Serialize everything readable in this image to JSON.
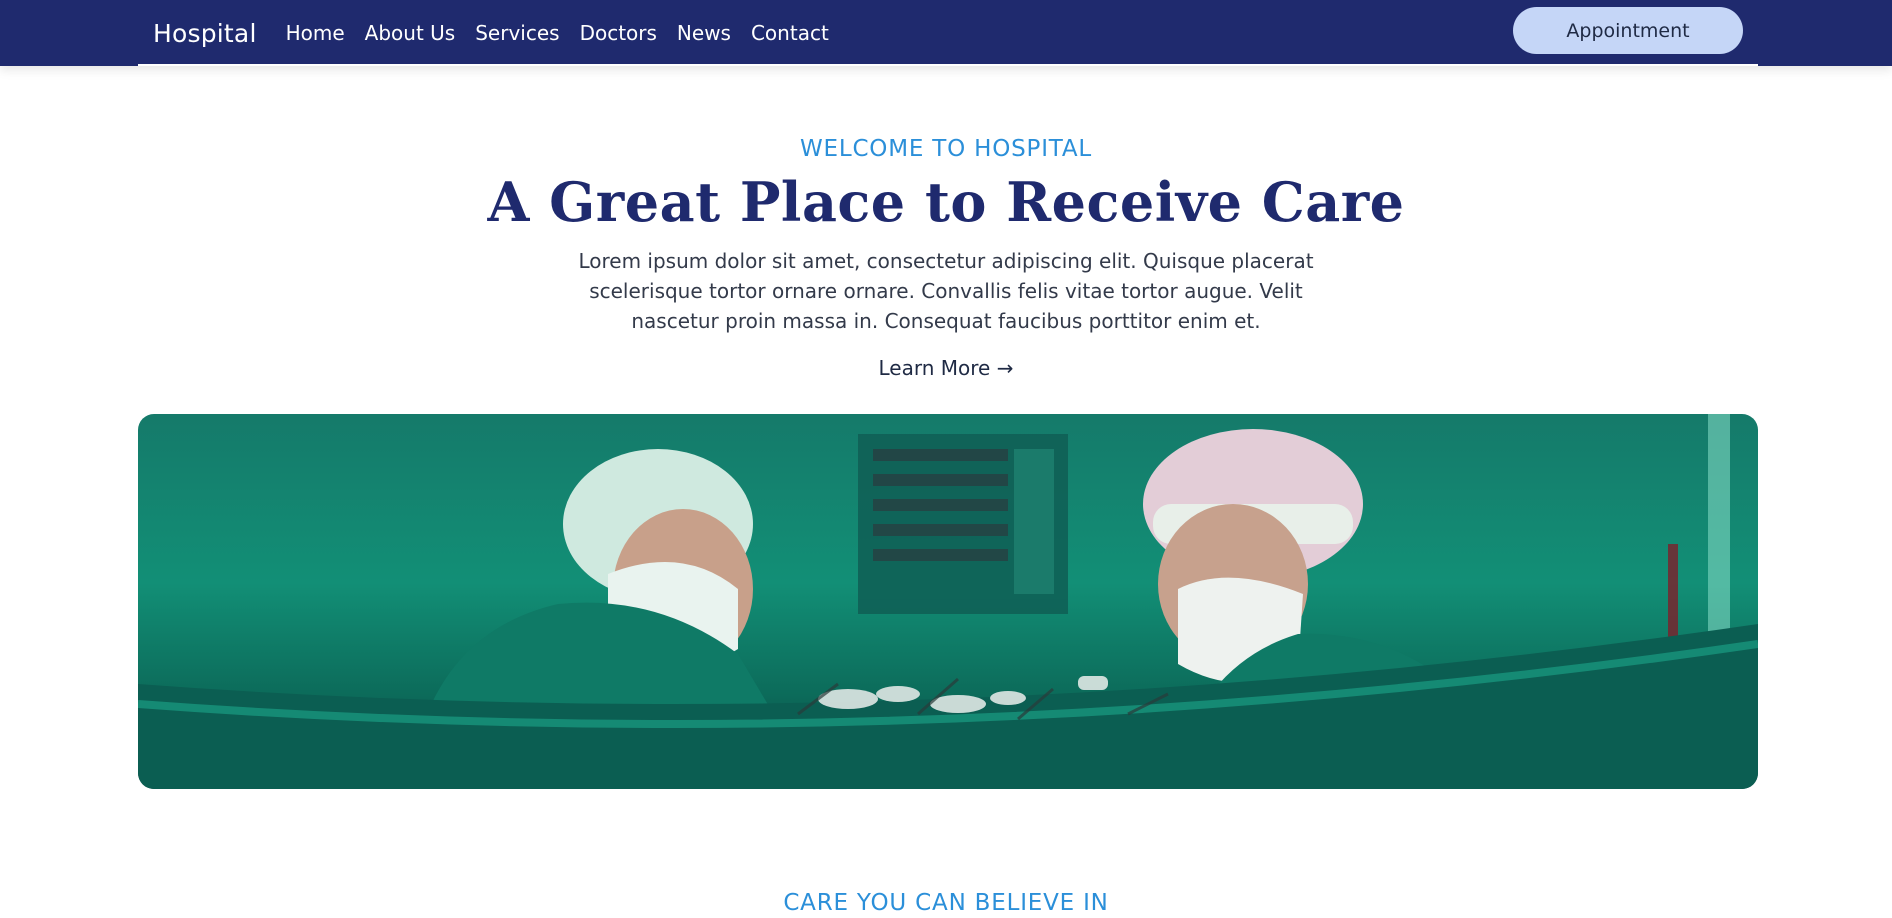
{
  "navbar": {
    "brand": "Hospital",
    "links": [
      "Home",
      "About Us",
      "Services",
      "Doctors",
      "News",
      "Contact"
    ],
    "cta": "Appointment"
  },
  "hero": {
    "eyebrow": "WELCOME TO HOSPITAL",
    "title": "A Great Place to Receive Care",
    "text": "Lorem ipsum dolor sit amet, consectetur adipiscing elit. Quisque placerat scelerisque tortor ornare ornare. Convallis felis vitae tortor augue. Velit nascetur proin massa in. Consequat faucibus porttitor enim et.",
    "learn_more": "Learn More →"
  },
  "section2": {
    "eyebrow": "CARE YOU CAN BELIEVE IN"
  },
  "colors": {
    "navbar_bg": "#1f2a6e",
    "accent_blue": "#2b8fd9",
    "cta_bg": "#c5d6f7",
    "title_navy": "#1f2a6e"
  }
}
